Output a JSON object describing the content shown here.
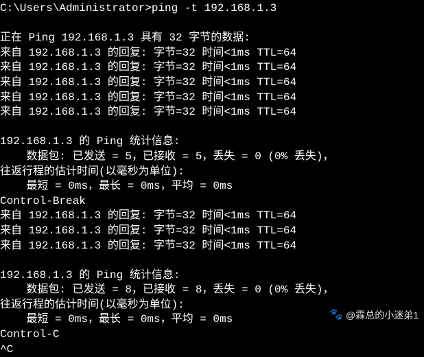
{
  "prompt": {
    "path": "C:\\Users\\Administrator>",
    "command": "ping -t 192.168.1.3"
  },
  "blank": " ",
  "ping_header": "正在 Ping 192.168.1.3 具有 32 字节的数据:",
  "replies1": [
    "来自 192.168.1.3 的回复: 字节=32 时间<1ms TTL=64",
    "来自 192.168.1.3 的回复: 字节=32 时间<1ms TTL=64",
    "来自 192.168.1.3 的回复: 字节=32 时间<1ms TTL=64",
    "来自 192.168.1.3 的回复: 字节=32 时间<1ms TTL=64",
    "来自 192.168.1.3 的回复: 字节=32 时间<1ms TTL=64"
  ],
  "stats1": {
    "header": "192.168.1.3 的 Ping 统计信息:",
    "packets": "    数据包: 已发送 = 5，已接收 = 5，丢失 = 0 (0% 丢失)，",
    "rtt_header": "往返行程的估计时间(以毫秒为单位):",
    "rtt_values": "    最短 = 0ms，最长 = 0ms，平均 = 0ms"
  },
  "control_break": "Control-Break",
  "replies2": [
    "来自 192.168.1.3 的回复: 字节=32 时间<1ms TTL=64",
    "来自 192.168.1.3 的回复: 字节=32 时间<1ms TTL=64",
    "来自 192.168.1.3 的回复: 字节=32 时间<1ms TTL=64"
  ],
  "stats2": {
    "header": "192.168.1.3 的 Ping 统计信息:",
    "packets": "    数据包: 已发送 = 8，已接收 = 8，丢失 = 0 (0% 丢失)，",
    "rtt_header": "往返行程的估计时间(以毫秒为单位):",
    "rtt_values": "    最短 = 0ms，最长 = 0ms，平均 = 0ms"
  },
  "control_c": "Control-C",
  "caret_c": "^C",
  "watermark": {
    "icon": "🐾",
    "text": "@霖总的小迷弟1"
  }
}
